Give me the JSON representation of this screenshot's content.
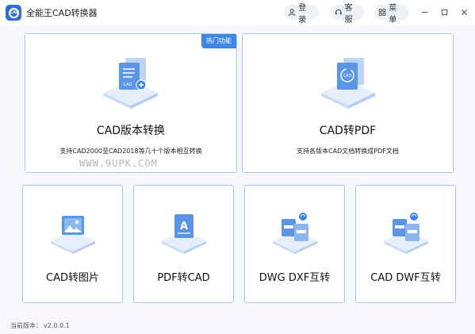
{
  "app": {
    "title": "全能王CAD转换器",
    "logo_text": "CAD"
  },
  "header": {
    "login_label": "登录",
    "service_label": "客服",
    "menu_label": "菜单"
  },
  "cards": {
    "version": {
      "badge": "热门功能",
      "title": "CAD版本转换",
      "desc": "支持CAD2000至CAD2018等几十个版本相互转换",
      "icon_text": "CAD"
    },
    "pdf": {
      "title": "CAD转PDF",
      "desc": "支持各版本CAD文档转换成PDF文档",
      "icon_text": "CAD"
    },
    "img": {
      "title": "CAD转图片"
    },
    "pdfcad": {
      "title": "PDF转CAD",
      "icon_text": "A"
    },
    "dwgdxf": {
      "title": "DWG DXF互转"
    },
    "dwf": {
      "title": "CAD DWF互转"
    }
  },
  "watermark": "WWW.9UPK.COM",
  "footer": {
    "version_label": "当前版本：",
    "version_value": "v2.0.0.1"
  },
  "colors": {
    "accent": "#3d86e8",
    "card_border": "#a9c6ea",
    "icon_light": "#dce8fb",
    "icon_mid": "#8db6ef"
  }
}
